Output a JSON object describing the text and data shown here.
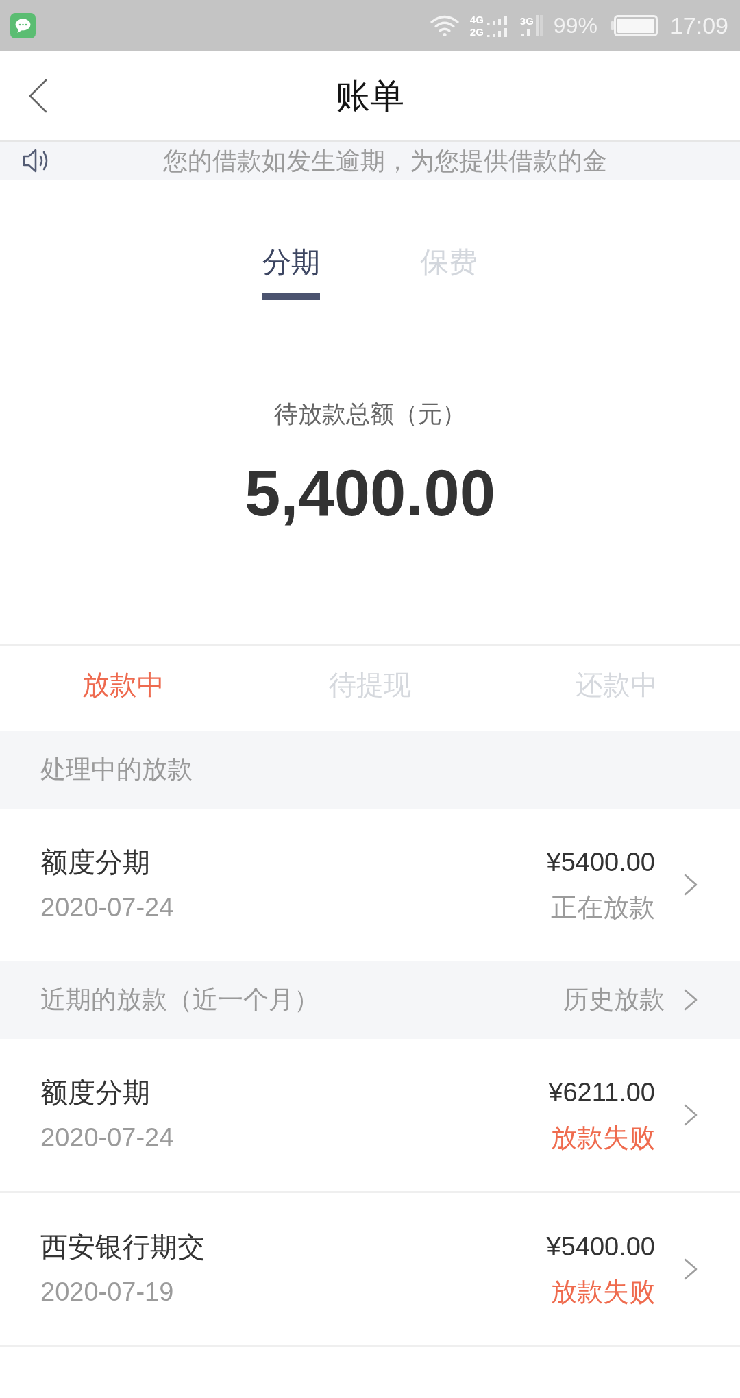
{
  "status_bar": {
    "sim1_networks": [
      "4G",
      "2G"
    ],
    "sim2_network": "3G",
    "battery": "99%",
    "time": "17:09"
  },
  "header": {
    "title": "账单"
  },
  "notice": {
    "text": "您的借款如发生逾期，为您提供借款的金"
  },
  "product_tabs": [
    {
      "label": "分期",
      "selected": true
    },
    {
      "label": "保费",
      "selected": false
    }
  ],
  "summary": {
    "label": "待放款总额（元）",
    "amount": "5,400.00"
  },
  "status_tabs": [
    {
      "label": "放款中",
      "selected": true
    },
    {
      "label": "待提现",
      "selected": false
    },
    {
      "label": "还款中",
      "selected": false
    }
  ],
  "sections": [
    {
      "title": "处理中的放款",
      "items": [
        {
          "name": "额度分期",
          "date": "2020-07-24",
          "amount": "¥5400.00",
          "status": "正在放款",
          "kind": "processing"
        }
      ]
    },
    {
      "title": "近期的放款（近一个月）",
      "link": "历史放款",
      "items": [
        {
          "name": "额度分期",
          "date": "2020-07-24",
          "amount": "¥6211.00",
          "status": "放款失败",
          "kind": "failed"
        },
        {
          "name": "西安银行期交",
          "date": "2020-07-19",
          "amount": "¥5400.00",
          "status": "放款失败",
          "kind": "failed"
        }
      ]
    }
  ]
}
